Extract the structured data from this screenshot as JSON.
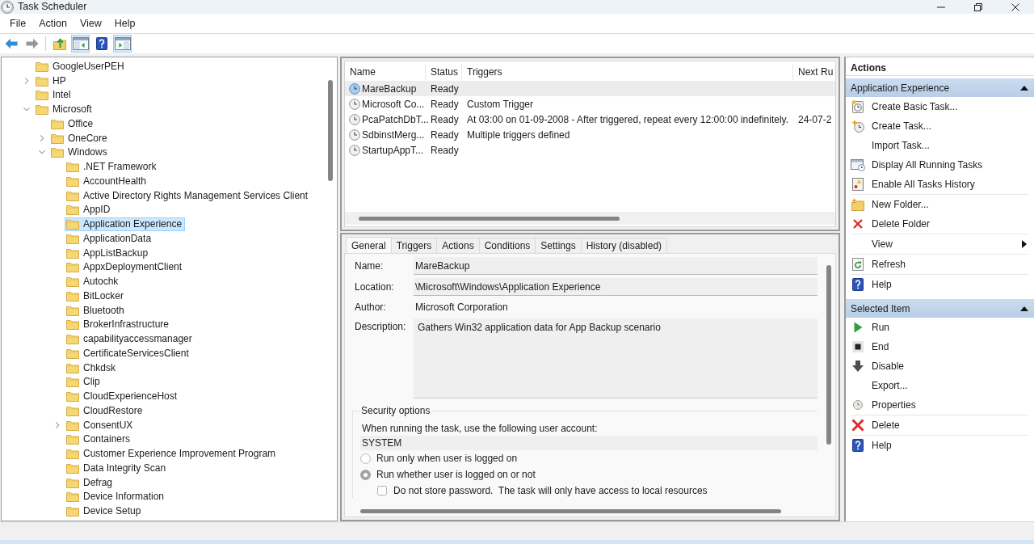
{
  "window": {
    "title": "Task Scheduler"
  },
  "menu": [
    "File",
    "Action",
    "View",
    "Help"
  ],
  "toolbar": {
    "groups": [
      [
        {
          "disabled": false,
          "pressed": false
        },
        {
          "disabled": true,
          "pressed": false
        }
      ],
      [
        {
          "disabled": false,
          "pressed": false
        },
        {
          "disabled": false,
          "pressed": true
        },
        {
          "disabled": false,
          "pressed": false
        },
        {
          "disabled": false,
          "pressed": true
        }
      ]
    ]
  },
  "tree": {
    "items": [
      {
        "label": "GoogleUserPEH",
        "selected": false
      },
      {
        "label": "HP",
        "expanded": false,
        "selected": false
      },
      {
        "label": "Intel",
        "selected": false
      },
      {
        "label": "Microsoft",
        "expanded": true,
        "selected": false,
        "children": [
          {
            "label": "Office",
            "selected": false
          },
          {
            "label": "OneCore",
            "expanded": false,
            "selected": false
          },
          {
            "label": "Windows",
            "expanded": true,
            "selected": false,
            "children": [
              {
                "label": ".NET Framework",
                "selected": false
              },
              {
                "label": "AccountHealth",
                "selected": false
              },
              {
                "label": "Active Directory Rights Management Services Client",
                "selected": false
              },
              {
                "label": "AppID",
                "selected": false
              },
              {
                "label": "Application Experience",
                "selected": true
              },
              {
                "label": "ApplicationData",
                "selected": false
              },
              {
                "label": "AppListBackup",
                "selected": false
              },
              {
                "label": "AppxDeploymentClient",
                "selected": false
              },
              {
                "label": "Autochk",
                "selected": false
              },
              {
                "label": "BitLocker",
                "selected": false
              },
              {
                "label": "Bluetooth",
                "selected": false
              },
              {
                "label": "BrokerInfrastructure",
                "selected": false
              },
              {
                "label": "capabilityaccessmanager",
                "selected": false
              },
              {
                "label": "CertificateServicesClient",
                "selected": false
              },
              {
                "label": "Chkdsk",
                "selected": false
              },
              {
                "label": "Clip",
                "selected": false
              },
              {
                "label": "CloudExperienceHost",
                "selected": false
              },
              {
                "label": "CloudRestore",
                "selected": false
              },
              {
                "label": "ConsentUX",
                "expanded": false,
                "selected": false
              },
              {
                "label": "Containers",
                "selected": false
              },
              {
                "label": "Customer Experience Improvement Program",
                "selected": false
              },
              {
                "label": "Data Integrity Scan",
                "selected": false
              },
              {
                "label": "Defrag",
                "selected": false
              },
              {
                "label": "Device Information",
                "selected": false
              },
              {
                "label": "Device Setup",
                "selected": false
              }
            ]
          }
        ]
      }
    ]
  },
  "task_list": {
    "columns": [
      "Name",
      "Status",
      "Triggers",
      "Next Ru"
    ],
    "rows": [
      {
        "name": "MareBackup",
        "status": "Ready",
        "selected": true
      },
      {
        "name": "Microsoft Co...",
        "status": "Ready",
        "triggers": "Custom Trigger",
        "selected": false
      },
      {
        "name": "PcaPatchDbT...",
        "status": "Ready",
        "triggers": "At 03:00 on 01-09-2008 - After triggered, repeat every 12:00:00 indefinitely.",
        "next_run": "24-07-2",
        "selected": false
      },
      {
        "name": "SdbinstMerg...",
        "status": "Ready",
        "triggers": "Multiple triggers defined",
        "selected": false
      },
      {
        "name": "StartupAppT...",
        "status": "Ready",
        "selected": false
      }
    ]
  },
  "task_details": {
    "tabs": [
      {
        "label": "General",
        "selected": true
      },
      {
        "label": "Triggers",
        "selected": false
      },
      {
        "label": "Actions",
        "selected": false
      },
      {
        "label": "Conditions",
        "selected": false
      },
      {
        "label": "Settings",
        "selected": false
      },
      {
        "label": "History (disabled)",
        "selected": false
      }
    ],
    "fields": [
      {
        "label": "Name:",
        "value": "MareBackup",
        "kind": "textbox"
      },
      {
        "label": "Location:",
        "value": "\\Microsoft\\Windows\\Application Experience",
        "kind": "textbox"
      },
      {
        "label": "Author:",
        "value": "Microsoft Corporation",
        "kind": "text"
      },
      {
        "label": "Description:",
        "value": "Gathers Win32 application data for App Backup scenario",
        "kind": "textarea"
      }
    ],
    "security": {
      "title": "Security options",
      "account_prompt": "When running the task, use the following user account:",
      "account": "SYSTEM",
      "options": [
        {
          "label": "Run only when user is logged on",
          "selected": false
        },
        {
          "label": "Run whether user is logged on or not",
          "selected": true,
          "children": [
            {
              "label": "Do not store password.  The task will only have access to local resources",
              "checked": false
            }
          ]
        }
      ]
    }
  },
  "actions_pane": {
    "title": "Actions",
    "sections": [
      {
        "title": "Application Experience",
        "expanded": true,
        "groups": [
          [
            {
              "label": "Create Basic Task...",
              "kind": "command"
            },
            {
              "label": "Create Task...",
              "kind": "command"
            },
            {
              "label": "Import Task...",
              "kind": "command"
            },
            {
              "label": "Display All Running Tasks",
              "kind": "command"
            },
            {
              "label": "Enable All Tasks History",
              "kind": "command"
            }
          ],
          [
            {
              "label": "New Folder...",
              "kind": "command"
            },
            {
              "label": "Delete Folder",
              "kind": "command"
            }
          ],
          [
            {
              "label": "View",
              "kind": "submenu"
            }
          ],
          [
            {
              "label": "Refresh",
              "kind": "command"
            }
          ],
          [
            {
              "label": "Help",
              "kind": "command"
            }
          ]
        ]
      },
      {
        "title": "Selected Item",
        "expanded": true,
        "groups": [
          [
            {
              "label": "Run",
              "kind": "command"
            },
            {
              "label": "End",
              "kind": "command"
            },
            {
              "label": "Disable",
              "kind": "command"
            },
            {
              "label": "Export...",
              "kind": "command"
            },
            {
              "label": "Properties",
              "kind": "command"
            }
          ],
          [
            {
              "label": "Delete",
              "kind": "command"
            }
          ],
          [
            {
              "label": "Help",
              "kind": "command"
            }
          ]
        ]
      }
    ]
  }
}
